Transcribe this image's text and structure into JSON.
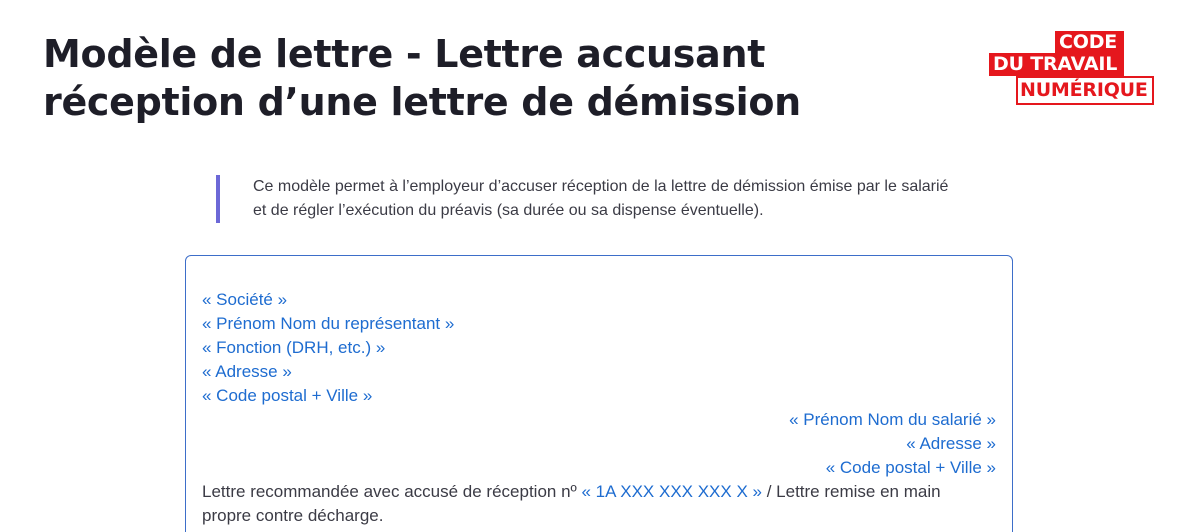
{
  "page": {
    "title_line1": "Modèle de lettre - Lettre accusant",
    "title_line2": "réception d’une lettre de démission"
  },
  "logo": {
    "line1": "CODE",
    "line2": "DU TRAVAIL",
    "line3": "NUMÉRIQUE",
    "brand_color": "#e5171d"
  },
  "intro": {
    "line1": "Ce modèle permet à l’employeur d’accuser réception de la lettre de démission émise par le salarié",
    "line2": "et de régler l’exécution du préavis (sa durée ou sa dispense éventuelle).",
    "accent_color": "#6c68d7"
  },
  "letter": {
    "border_color": "#3d6ec9",
    "placeholder_color": "#1e6cd0",
    "sender": [
      "« Société »",
      "« Prénom Nom du représentant »",
      "« Fonction (DRH, etc.) »",
      "« Adresse »",
      "« Code postal + Ville »"
    ],
    "recipient": [
      "« Prénom Nom du salarié »",
      "« Adresse »",
      "« Code postal + Ville »"
    ],
    "mention": {
      "prefix": "Lettre recommandée avec accusé de réception nº ",
      "number_placeholder": "« 1A XXX XXX XXX X »",
      "suffix": " / Lettre remise en main propre contre décharge."
    }
  }
}
